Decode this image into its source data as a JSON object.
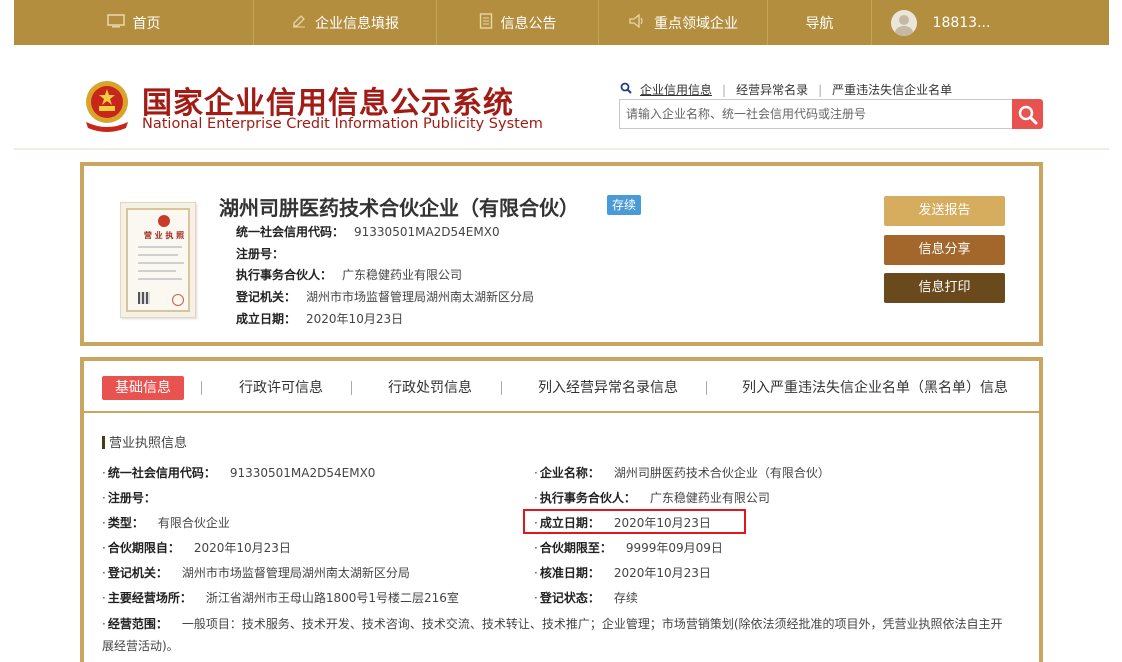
{
  "nav": {
    "items": [
      {
        "label": "首页",
        "icon": "monitor-icon"
      },
      {
        "label": "企业信息填报",
        "icon": "edit-icon"
      },
      {
        "label": "信息公告",
        "icon": "document-icon"
      },
      {
        "label": "重点领域企业",
        "icon": "speaker-icon"
      },
      {
        "label": "导航",
        "icon": ""
      }
    ],
    "user": "18813..."
  },
  "site": {
    "title_cn": "国家企业信用信息公示系统",
    "title_en": "National Enterprise Credit Information Publicity System"
  },
  "search": {
    "links": [
      "企业信用信息",
      "经营异常名录",
      "严重违法失信企业名单"
    ],
    "placeholder": "请输入企业名称、统一社会信用代码或注册号"
  },
  "company": {
    "name": "湖州司肼医药技术合伙企业（有限合伙）",
    "status": "存续",
    "rows": [
      {
        "label": "统一社会信用代码：",
        "value": "91330501MA2D54EMX0"
      },
      {
        "label": "注册号：",
        "value": ""
      },
      {
        "label": "执行事务合伙人：",
        "value": "广东稳健药业有限公司"
      },
      {
        "label": "登记机关：",
        "value": "湖州市市场监督管理局湖州南太湖新区分局"
      },
      {
        "label": "成立日期：",
        "value": "2020年10月23日"
      }
    ],
    "license_title": "营 业 执 照"
  },
  "actions": {
    "send": "发送报告",
    "share": "信息分享",
    "print": "信息打印"
  },
  "tabs": [
    "基础信息",
    "行政许可信息",
    "行政处罚信息",
    "列入经营异常名录信息",
    "列入严重违法失信企业名单（黑名单）信息"
  ],
  "details": {
    "section_title": "营业执照信息",
    "dot": "·",
    "left": [
      {
        "label": "统一社会信用代码：",
        "value": "91330501MA2D54EMX0"
      },
      {
        "label": "注册号：",
        "value": ""
      },
      {
        "label": "类型：",
        "value": "有限合伙企业"
      },
      {
        "label": "合伙期限自：",
        "value": "2020年10月23日"
      },
      {
        "label": "登记机关：",
        "value": "湖州市市场监督管理局湖州南太湖新区分局"
      },
      {
        "label": "主要经营场所：",
        "value": "浙江省湖州市王母山路1800号1号楼二层216室"
      }
    ],
    "right": [
      {
        "label": "企业名称：",
        "value": "湖州司肼医药技术合伙企业（有限合伙）"
      },
      {
        "label": "执行事务合伙人：",
        "value": "广东稳健药业有限公司"
      },
      {
        "label": "成立日期：",
        "value": "2020年10月23日"
      },
      {
        "label": "合伙期限至：",
        "value": "9999年09月09日"
      },
      {
        "label": "核准日期：",
        "value": "2020年10月23日"
      },
      {
        "label": "登记状态：",
        "value": "存续"
      }
    ],
    "scope": {
      "label": "经营范围：",
      "value": "一般项目：技术服务、技术开发、技术咨询、技术交流、技术转让、技术推广；企业管理；市场营销策划(除依法须经批准的项目外，凭营业执照依法自主开展经营活动)。"
    }
  },
  "colors": {
    "gold": "#b38e3f",
    "brand_red": "#a21b14",
    "active_tab": "#e8524f",
    "highlight": "#e0171b",
    "status_blue": "#4a9ad8"
  }
}
